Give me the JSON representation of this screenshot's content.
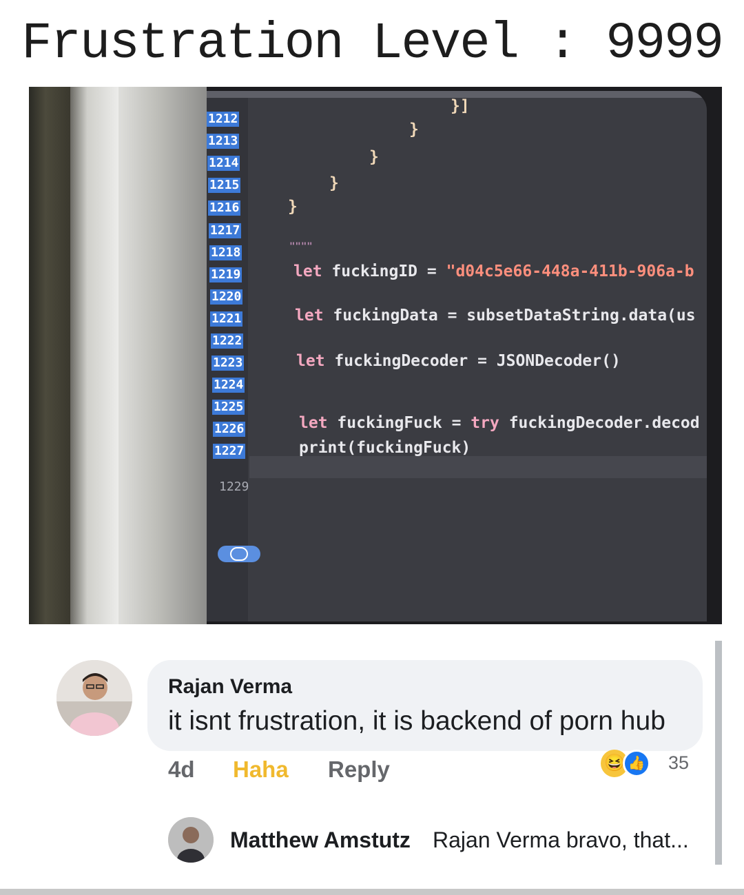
{
  "meme": {
    "title": "Frustration Level : 9999"
  },
  "code_editor": {
    "top_fragment": "}]",
    "lines": [
      {
        "no": "1212",
        "code": "}"
      },
      {
        "no": "1213",
        "code": ""
      },
      {
        "no": "1214",
        "code": "}"
      },
      {
        "no": "1215",
        "code": "}"
      },
      {
        "no": "1216",
        "code": "}"
      },
      {
        "no": "1217",
        "code": ""
      },
      {
        "no": "1218",
        "code": "\"\"\"\""
      },
      {
        "no": "1219",
        "code": "let fuckingID = \"d04c5e66-448a-411b-906a-b"
      },
      {
        "no": "1220",
        "code": ""
      },
      {
        "no": "1221",
        "code": "let fuckingData = subsetDataString.data(us"
      },
      {
        "no": "1222",
        "code": ""
      },
      {
        "no": "1223",
        "code": "let fuckingDecoder = JSONDecoder()"
      },
      {
        "no": "1224",
        "code": ""
      },
      {
        "no": "1225",
        "code": ""
      },
      {
        "no": "1226",
        "code": "let fuckingFuck = try fuckingDecoder.decod"
      },
      {
        "no": "1227",
        "code": "print(fuckingFuck)"
      },
      {
        "no": "1229",
        "code": ""
      }
    ],
    "code_parts": {
      "let": "let",
      "id_name": "fuckingID =",
      "id_value": "\"d04c5e66-448a-411b-906a-b",
      "data_rest": "fuckingData = subsetDataString.data(us",
      "decoder_rest": "fuckingDecoder = JSONDecoder()",
      "fuck_name": "fuckingFuck =",
      "try": "try",
      "fuck_rest": "fuckingDecoder.decod",
      "print_line": "print(fuckingFuck)",
      "doc_quotes": "\"\"\"\"",
      "brace": "}"
    },
    "colors": {
      "background": "#3b3c42",
      "gutter_highlight": "#3d7ad8",
      "keyword": "#f4a8c0",
      "string": "#ff8f7d"
    }
  },
  "comment": {
    "author": "Rajan Verma",
    "text": "it isnt frustration, it is backend of porn hub",
    "time": "4d",
    "haha_label": "Haha",
    "reply_label": "Reply",
    "reaction_count": "35",
    "reactions": [
      "haha-icon",
      "like-icon"
    ]
  },
  "reply": {
    "author": "Matthew Amstutz",
    "text": "Rajan Verma bravo, that..."
  }
}
